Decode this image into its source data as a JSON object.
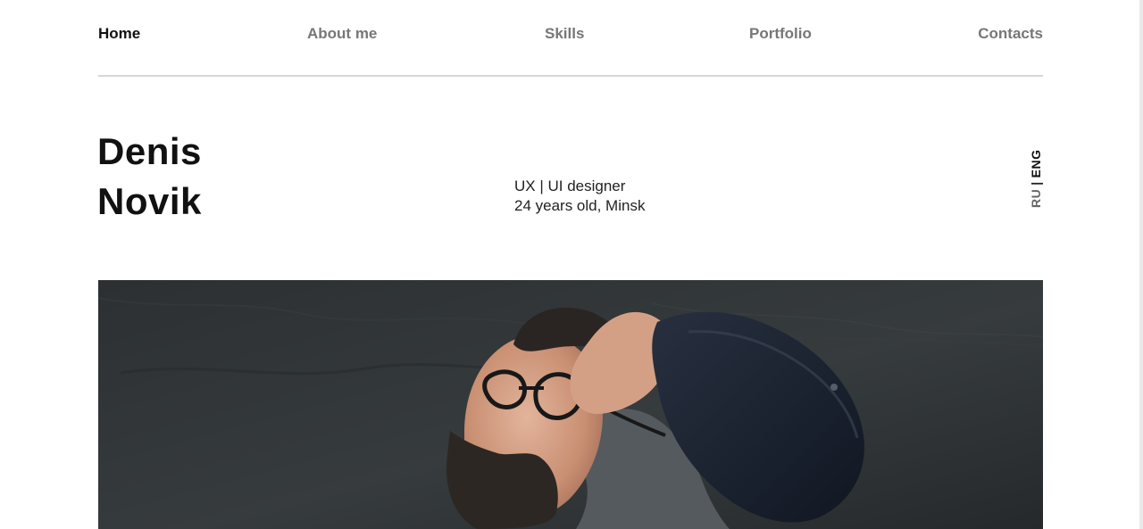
{
  "nav": {
    "items": [
      {
        "label": "Home",
        "active": true
      },
      {
        "label": "About me",
        "active": false
      },
      {
        "label": "Skills",
        "active": false
      },
      {
        "label": "Portfolio",
        "active": false
      },
      {
        "label": "Contacts",
        "active": false
      }
    ]
  },
  "hero": {
    "first_name": "Denis",
    "last_name": "Novik",
    "role": "UX | UI designer",
    "details": "24 years old, Minsk"
  },
  "language": {
    "ru": "RU",
    "separator": "|",
    "eng": "ENG",
    "active": "ENG"
  },
  "photo": {
    "icon": "portrait-photo",
    "background_color": "#2f3335"
  },
  "colors": {
    "text": "#111111",
    "nav_inactive": "#777777",
    "divider": "#d6d6d6"
  }
}
